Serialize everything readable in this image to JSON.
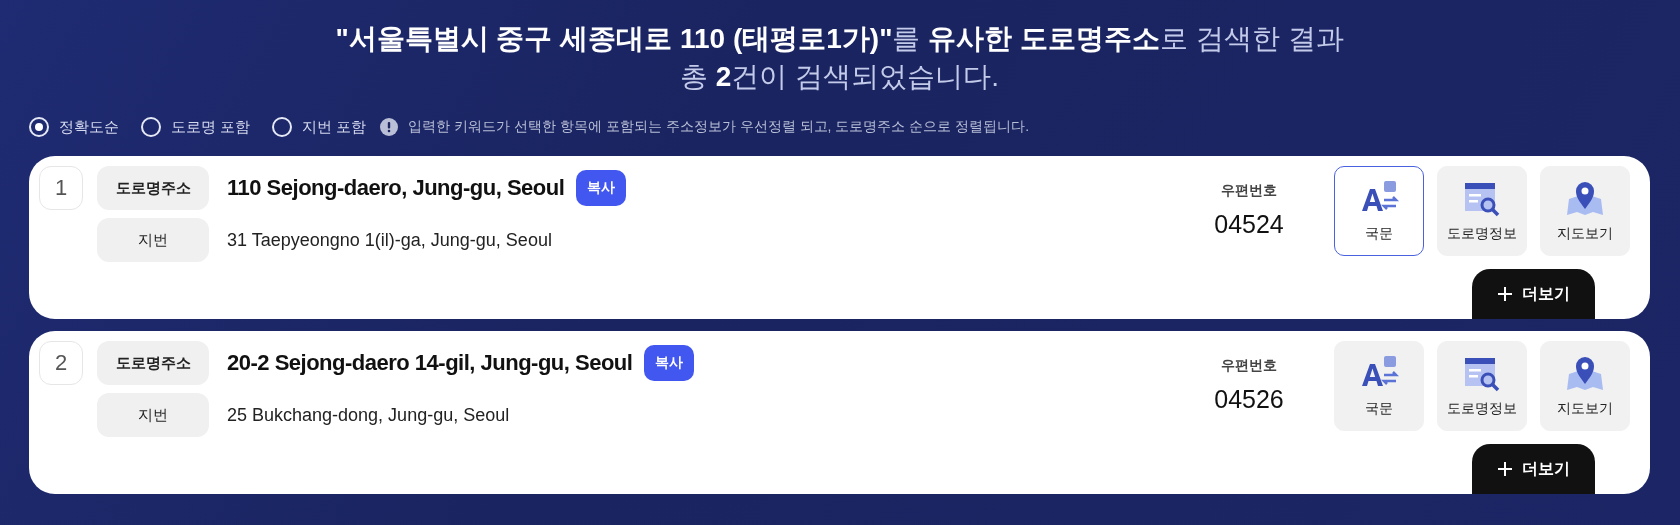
{
  "heading": {
    "line_1": "**\"서울특별시 중구 세종대로 110 (태평로1가)\"**를 **유사한 도로명주소**로 검색한 결과",
    "line_2": "총 **2**건이 검색되었습니다."
  },
  "sort_options": [
    {
      "label": "정확도순",
      "selected": true
    },
    {
      "label": "도로명 포함",
      "selected": false
    },
    {
      "label": "지번 포함",
      "selected": false
    }
  ],
  "sort_hint": "입력한 키워드가 선택한 항목에 포함되는 주소정보가 우선정렬 되고, 도로명주소 순으로 정렬됩니다.",
  "results": [
    {
      "number": "1",
      "road_label": "도로명주소",
      "road_address": "110 Sejong-daero, Jung-gu, Seoul",
      "copy": "복사",
      "lot_label": "지번",
      "lot_address": "31 Taepyeongno 1(il)-ga, Jung-gu, Seoul",
      "zip_label": "우편번호",
      "zip": "04524",
      "actions": [
        {
          "kind": "korean",
          "label": "국문",
          "selected": true
        },
        {
          "kind": "road_info",
          "label": "도로명정보",
          "selected": false
        },
        {
          "kind": "map",
          "label": "지도보기",
          "selected": false
        }
      ],
      "more": "더보기"
    },
    {
      "number": "2",
      "road_label": "도로명주소",
      "road_address": "20-2 Sejong-daero 14-gil, Jung-gu, Seoul",
      "copy": "복사",
      "lot_label": "지번",
      "lot_address": "25 Bukchang-dong, Jung-gu, Seoul",
      "zip_label": "우편번호",
      "zip": "04526",
      "actions": [
        {
          "kind": "korean",
          "label": "국문",
          "selected": false
        },
        {
          "kind": "road_info",
          "label": "도로명정보",
          "selected": false
        },
        {
          "kind": "map",
          "label": "지도보기",
          "selected": false
        }
      ],
      "more": "더보기"
    }
  ]
}
